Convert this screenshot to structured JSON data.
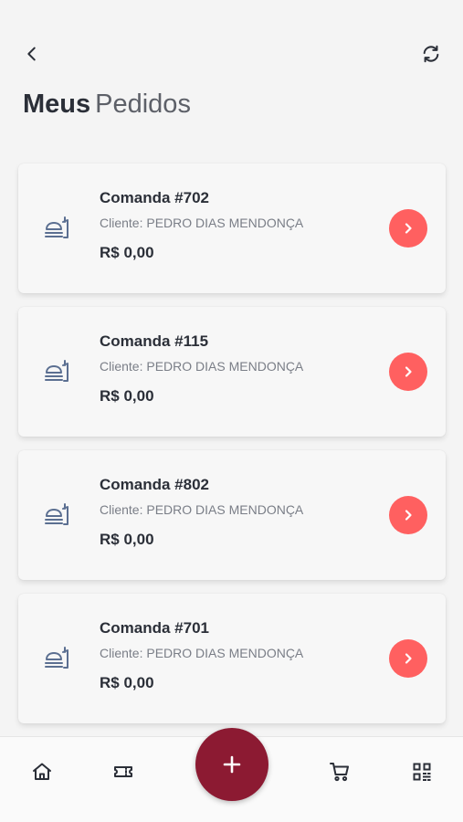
{
  "header": {
    "back_icon": "chevron-left-icon",
    "refresh_icon": "refresh-icon",
    "title_bold": "Meus",
    "title_light": "Pedidos"
  },
  "colors": {
    "accent": "#ff6060",
    "fab": "#8c1a32",
    "text": "#2b2f38",
    "muted": "#7a7e87",
    "icon": "#5b6f91"
  },
  "orders": [
    {
      "title": "Comanda #702",
      "client": "Cliente: PEDRO DIAS MENDONÇA",
      "total": "R$ 0,00"
    },
    {
      "title": "Comanda #115",
      "client": "Cliente: PEDRO DIAS MENDONÇA",
      "total": "R$ 0,00"
    },
    {
      "title": "Comanda #802",
      "client": "Cliente: PEDRO DIAS MENDONÇA",
      "total": "R$ 0,00"
    },
    {
      "title": "Comanda #701",
      "client": "Cliente: PEDRO DIAS MENDONÇA",
      "total": "R$ 0,00"
    }
  ],
  "bottom_nav": {
    "items": [
      {
        "icon": "home-icon"
      },
      {
        "icon": "ticket-icon"
      },
      {
        "icon": "plus-icon"
      },
      {
        "icon": "cart-icon"
      },
      {
        "icon": "qr-code-icon"
      }
    ]
  }
}
